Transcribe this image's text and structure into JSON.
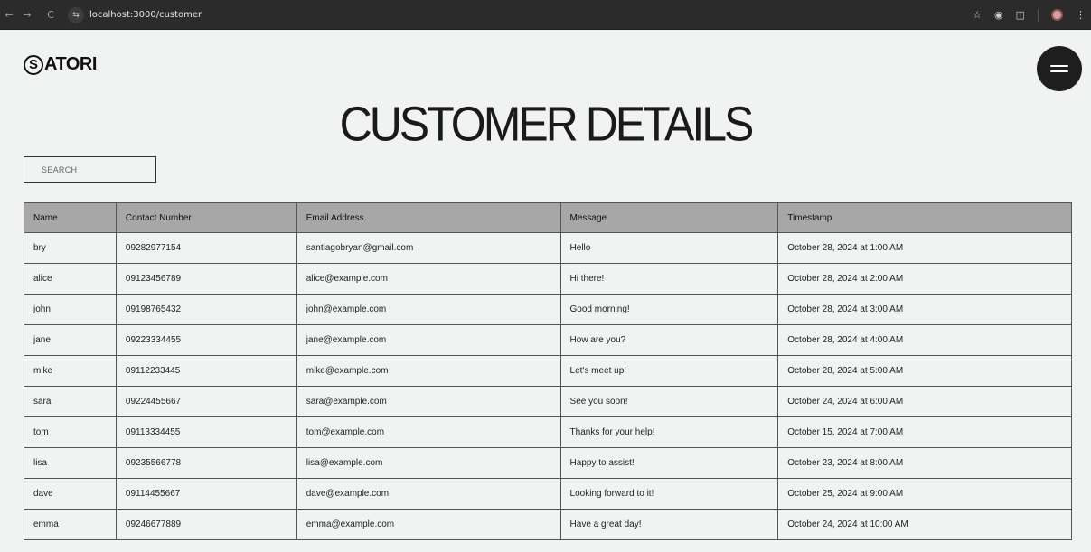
{
  "browser": {
    "back_icon": "←",
    "forward_icon": "→",
    "reload_icon": "C",
    "site_info_icon": "⇆",
    "url": "localhost:3000/customer"
  },
  "header": {
    "logo_initial": "S",
    "logo_text": "ATORI",
    "title": "CUSTOMER DETAILS"
  },
  "search": {
    "placeholder": "SEARCH",
    "value": ""
  },
  "table": {
    "columns": [
      "Name",
      "Contact Number",
      "Email Address",
      "Message",
      "Timestamp"
    ],
    "rows": [
      [
        "bry",
        "09282977154",
        "santiagobryan@gmail.com",
        "Hello",
        "October 28, 2024 at 1:00 AM"
      ],
      [
        "alice",
        "09123456789",
        "alice@example.com",
        "Hi there!",
        "October 28, 2024 at 2:00 AM"
      ],
      [
        "john",
        "09198765432",
        "john@example.com",
        "Good morning!",
        "October 28, 2024 at 3:00 AM"
      ],
      [
        "jane",
        "09223334455",
        "jane@example.com",
        "How are you?",
        "October 28, 2024 at 4:00 AM"
      ],
      [
        "mike",
        "09112233445",
        "mike@example.com",
        "Let's meet up!",
        "October 28, 2024 at 5:00 AM"
      ],
      [
        "sara",
        "09224455667",
        "sara@example.com",
        "See you soon!",
        "October 24, 2024 at 6:00 AM"
      ],
      [
        "tom",
        "09113334455",
        "tom@example.com",
        "Thanks for your help!",
        "October 15, 2024 at 7:00 AM"
      ],
      [
        "lisa",
        "09235566778",
        "lisa@example.com",
        "Happy to assist!",
        "October 23, 2024 at 8:00 AM"
      ],
      [
        "dave",
        "09114455667",
        "dave@example.com",
        "Looking forward to it!",
        "October 25, 2024 at 9:00 AM"
      ],
      [
        "emma",
        "09246677889",
        "emma@example.com",
        "Have a great day!",
        "October 24, 2024 at 10:00 AM"
      ]
    ]
  }
}
